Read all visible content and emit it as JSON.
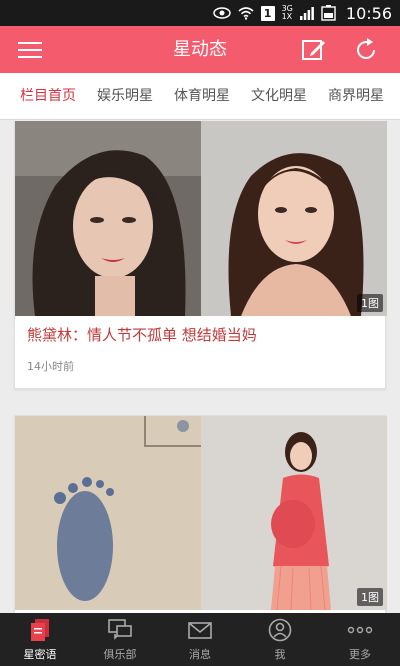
{
  "status_bar": {
    "time": "10:56",
    "network_top": "3G",
    "network_bottom": "1X",
    "sim_label": "1",
    "icons": [
      "eye-icon",
      "wifi-icon",
      "signal-icon",
      "battery-icon"
    ]
  },
  "header": {
    "title": "星动态",
    "menu_icon": "hamburger-menu-icon",
    "edit_icon": "edit-icon",
    "refresh_icon": "refresh-icon",
    "color": "#f45c6e"
  },
  "tabs": [
    {
      "label": "栏目首页",
      "active": true
    },
    {
      "label": "娱乐明星",
      "active": false
    },
    {
      "label": "体育明星",
      "active": false
    },
    {
      "label": "文化明星",
      "active": false
    },
    {
      "label": "商界明星",
      "active": false
    }
  ],
  "feed": {
    "cards": [
      {
        "title": "熊黛林：情人节不孤单 想结婚当妈",
        "time": "14小时前",
        "photo_count": "1图"
      },
      {
        "title": "",
        "time": "",
        "photo_count": "1图"
      }
    ]
  },
  "bottom_nav": [
    {
      "label": "星密语",
      "icon": "document-icon",
      "active": true
    },
    {
      "label": "俱乐部",
      "icon": "chat-bubbles-icon",
      "active": false
    },
    {
      "label": "消息",
      "icon": "envelope-icon",
      "active": false
    },
    {
      "label": "我",
      "icon": "person-icon",
      "active": false
    },
    {
      "label": "更多",
      "icon": "more-dots-icon",
      "active": false
    }
  ],
  "colors": {
    "accent": "#f45c6e",
    "active_tab": "#d8323f",
    "title_red": "#c23a3a",
    "nav_bg": "#222222"
  }
}
